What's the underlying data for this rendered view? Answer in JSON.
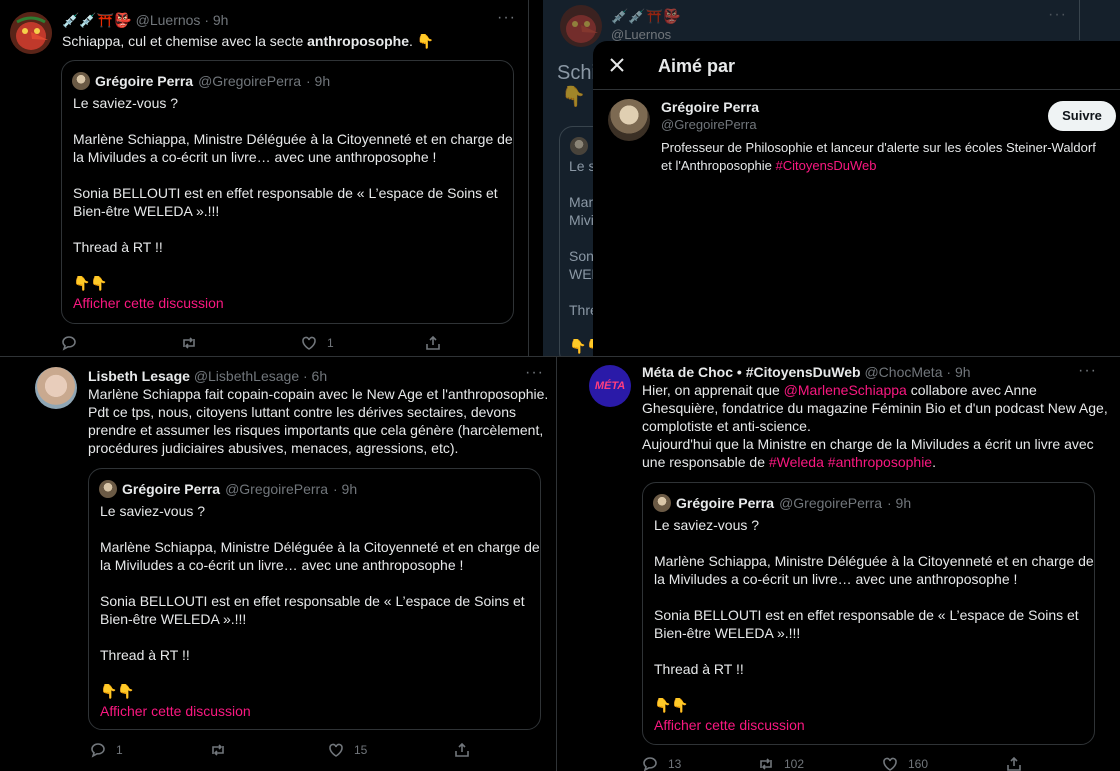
{
  "tweet_tl": {
    "emojis": "💉💉⛩️👺",
    "handle": "@Luernos",
    "time": "· 9h",
    "text_a": "Schiappa, cul et chemise avec la secte ",
    "text_b": "anthroposophe",
    "text_c": ". 👇",
    "reply_count": "",
    "retweet_count": "",
    "like_count": "1",
    "share_count": ""
  },
  "quote": {
    "name": "Grégoire Perra",
    "handle": "@GregoirePerra",
    "time": "· 9h",
    "lines": [
      "Le saviez-vous ?",
      "",
      "Marlène Schiappa, Ministre Déléguée à la Citoyenneté et en charge de",
      "la Miviludes a co-écrit un livre… avec une anthroposophe !",
      "",
      "Sonia BELLOUTI est en effet responsable de « L’espace de Soins et",
      "Bien-être WELEDA ».!!!",
      "",
      "Thread à RT   !!",
      "",
      "👇👇"
    ],
    "show_thread": "Afficher cette discussion"
  },
  "tweet_tr_bg": {
    "emojis": "💉💉⛩️👺",
    "handle": "@Luernos",
    "snippet": "Schi",
    "emoji_line": "👇",
    "quote_lines": [
      "Le s",
      "",
      "Marl",
      "Mivi",
      "",
      "Son",
      "WEL",
      "",
      "Thre",
      "",
      "👇👇"
    ]
  },
  "liked_by": {
    "title": "Aimé par",
    "user_name": "Grégoire Perra",
    "user_handle": "@GregoirePerra",
    "bio_line1": "Professeur de Philosophie et lanceur d'alerte sur les écoles Steiner-Waldorf",
    "bio_line2a": "et l'Anthroposophie ",
    "bio_hashtag": "#CitoyensDuWeb",
    "follow_label": "Suivre"
  },
  "tweet_bl": {
    "name": "Lisbeth Lesage",
    "handle": "@LisbethLesage",
    "time": "· 6h",
    "lines": [
      "Marlène Schiappa fait copain-copain avec le New Age et l'anthroposophie.",
      "Pdt ce tps, nous, citoyens luttant contre les dérives sectaires, devons",
      "prendre et assumer les risques importants que cela génère (harcèlement,",
      "procédures judiciaires abusives, menaces, agressions, etc)."
    ],
    "reply_count": "1",
    "retweet_count": "",
    "like_count": "15",
    "share_count": ""
  },
  "tweet_br": {
    "name": "Méta de Choc • #CitoyensDuWeb",
    "handle": "@ChocMeta",
    "time": "· 9h",
    "avatar_text": "MÉTA",
    "l1a": "Hier, on apprenait que ",
    "l1b": "@MarleneSchiappa",
    "l1c": " collabore avec Anne",
    "l2": "Ghesquière, fondatrice du magazine Féminin Bio et d'un podcast New Age,",
    "l3": "complotiste et anti-science.",
    "l4": "Aujourd'hui que la Ministre en charge de la Miviludes a écrit un livre avec",
    "l5a": "une responsable de ",
    "l5b": "#Weleda",
    "l5c": "#anthroposophie",
    "l5d": ".",
    "reply_count": "13",
    "retweet_count": "102",
    "like_count": "160",
    "share_count": ""
  },
  "colors": {
    "background": "#000000",
    "text": "#e7e9ea",
    "muted": "#71767b",
    "border": "#2f3336",
    "link": "#f91880",
    "overlay_bg": "#15202b"
  }
}
